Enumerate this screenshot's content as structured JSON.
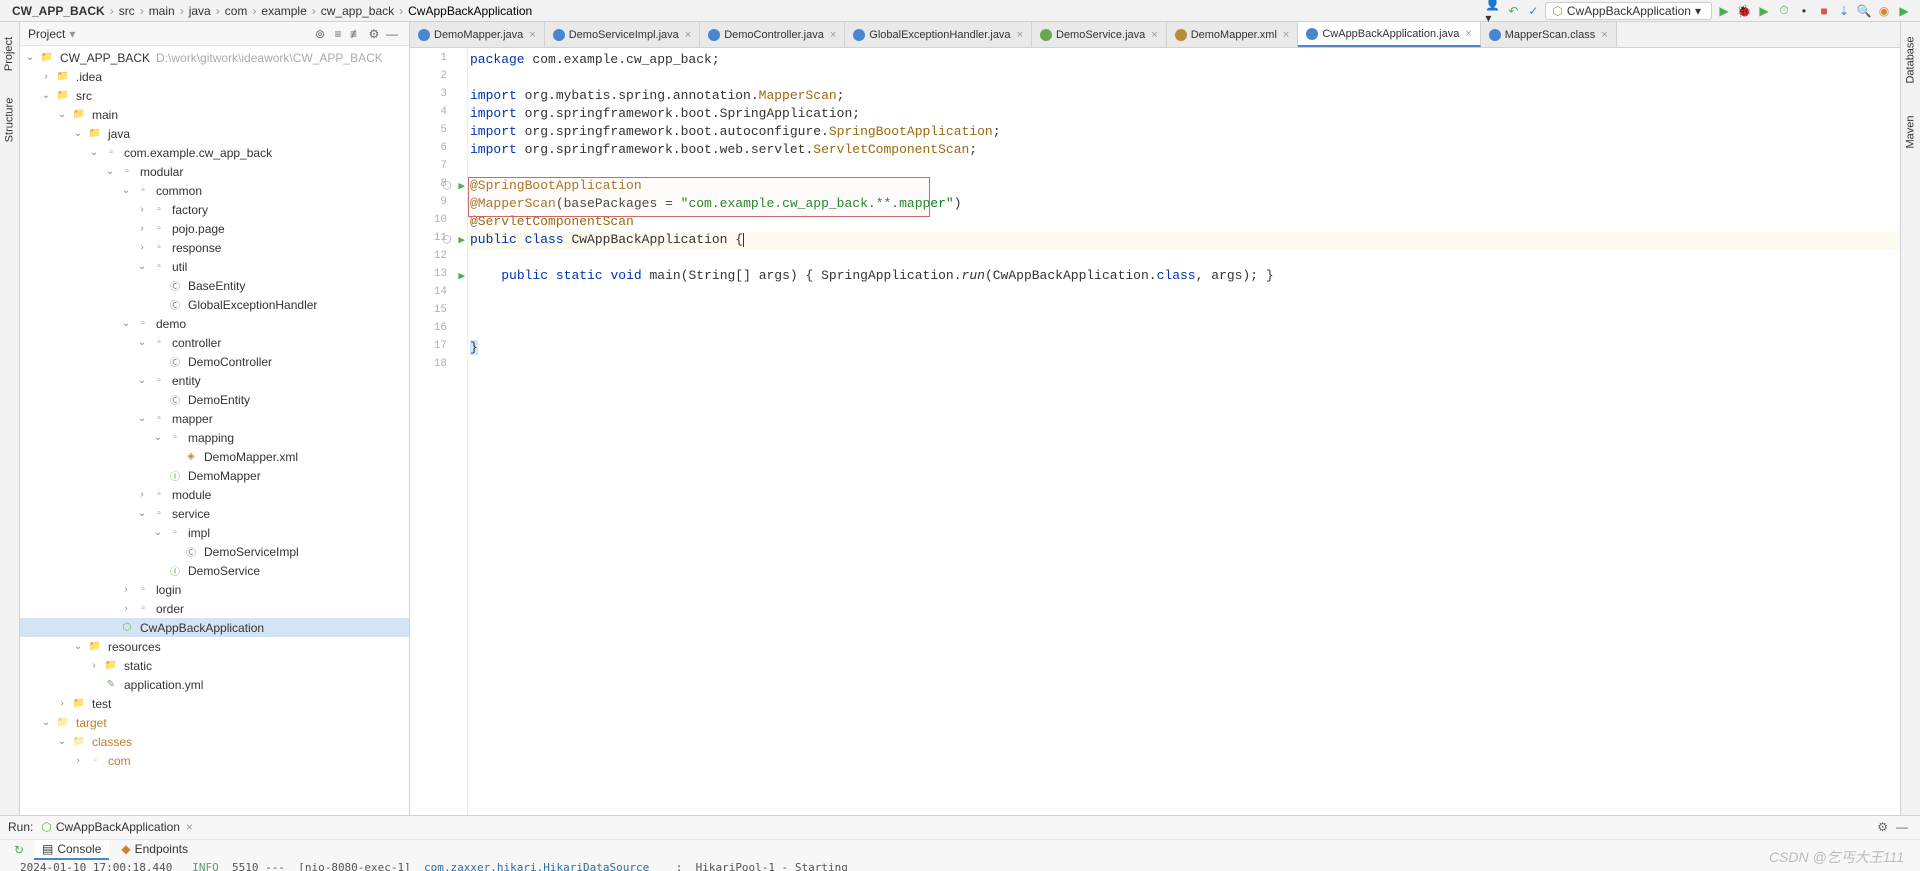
{
  "breadcrumb": {
    "items": [
      "CW_APP_BACK",
      "src",
      "main",
      "java",
      "com",
      "example",
      "cw_app_back",
      "CwAppBackApplication"
    ]
  },
  "runConfig": {
    "name": "CwAppBackApplication"
  },
  "sideLeft": [
    "Project",
    "Structure"
  ],
  "sideRight": [
    "Database",
    "Maven"
  ],
  "projectPanel": {
    "title": "Project",
    "tree": [
      {
        "d": 0,
        "a": "v",
        "i": "folder",
        "t": "CW_APP_BACK",
        "hint": "D:\\work\\gitwork\\ideawork\\CW_APP_BACK"
      },
      {
        "d": 1,
        "a": ">",
        "i": "folder",
        "t": ".idea"
      },
      {
        "d": 1,
        "a": "v",
        "i": "folder-src",
        "t": "src"
      },
      {
        "d": 2,
        "a": "v",
        "i": "folder-src",
        "t": "main"
      },
      {
        "d": 3,
        "a": "v",
        "i": "folder-src",
        "t": "java"
      },
      {
        "d": 4,
        "a": "v",
        "i": "pkg",
        "t": "com.example.cw_app_back"
      },
      {
        "d": 5,
        "a": "v",
        "i": "pkg",
        "t": "modular"
      },
      {
        "d": 6,
        "a": "v",
        "i": "pkg",
        "t": "common"
      },
      {
        "d": 7,
        "a": ">",
        "i": "pkg",
        "t": "factory"
      },
      {
        "d": 7,
        "a": ">",
        "i": "pkg",
        "t": "pojo.page"
      },
      {
        "d": 7,
        "a": ">",
        "i": "pkg",
        "t": "response"
      },
      {
        "d": 7,
        "a": "v",
        "i": "pkg",
        "t": "util"
      },
      {
        "d": 8,
        "a": "",
        "i": "jclass",
        "t": "BaseEntity"
      },
      {
        "d": 8,
        "a": "",
        "i": "jclass",
        "t": "GlobalExceptionHandler"
      },
      {
        "d": 6,
        "a": "v",
        "i": "pkg",
        "t": "demo"
      },
      {
        "d": 7,
        "a": "v",
        "i": "pkg",
        "t": "controller"
      },
      {
        "d": 8,
        "a": "",
        "i": "jclass",
        "t": "DemoController"
      },
      {
        "d": 7,
        "a": "v",
        "i": "pkg",
        "t": "entity"
      },
      {
        "d": 8,
        "a": "",
        "i": "jclass",
        "t": "DemoEntity"
      },
      {
        "d": 7,
        "a": "v",
        "i": "pkg",
        "t": "mapper"
      },
      {
        "d": 8,
        "a": "v",
        "i": "pkg",
        "t": "mapping"
      },
      {
        "d": 9,
        "a": "",
        "i": "xmlf",
        "t": "DemoMapper.xml"
      },
      {
        "d": 8,
        "a": "",
        "i": "jinterface",
        "t": "DemoMapper"
      },
      {
        "d": 7,
        "a": ">",
        "i": "pkg",
        "t": "module"
      },
      {
        "d": 7,
        "a": "v",
        "i": "pkg",
        "t": "service"
      },
      {
        "d": 8,
        "a": "v",
        "i": "pkg",
        "t": "impl"
      },
      {
        "d": 9,
        "a": "",
        "i": "jclass",
        "t": "DemoServiceImpl"
      },
      {
        "d": 8,
        "a": "",
        "i": "jinterface",
        "t": "DemoService"
      },
      {
        "d": 6,
        "a": ">",
        "i": "pkg",
        "t": "login"
      },
      {
        "d": 6,
        "a": ">",
        "i": "pkg",
        "t": "order"
      },
      {
        "d": 5,
        "a": "",
        "i": "spring",
        "t": "CwAppBackApplication",
        "sel": true
      },
      {
        "d": 3,
        "a": "v",
        "i": "folder-res",
        "t": "resources"
      },
      {
        "d": 4,
        "a": ">",
        "i": "folder",
        "t": "static"
      },
      {
        "d": 4,
        "a": "",
        "i": "yml",
        "t": "application.yml"
      },
      {
        "d": 2,
        "a": ">",
        "i": "folder-test",
        "t": "test"
      },
      {
        "d": 1,
        "a": "v",
        "i": "folder",
        "t": "target",
        "excl": true
      },
      {
        "d": 2,
        "a": "v",
        "i": "folder",
        "t": "classes",
        "excl": true
      },
      {
        "d": 3,
        "a": ">",
        "i": "pkg",
        "t": "com",
        "excl": true
      }
    ]
  },
  "tabs": [
    {
      "name": "DemoMapper.java",
      "i": "j"
    },
    {
      "name": "DemoServiceImpl.java",
      "i": "j"
    },
    {
      "name": "DemoController.java",
      "i": "j"
    },
    {
      "name": "GlobalExceptionHandler.java",
      "i": "j"
    },
    {
      "name": "DemoService.java",
      "i": "i"
    },
    {
      "name": "DemoMapper.xml",
      "i": "x"
    },
    {
      "name": "CwAppBackApplication.java",
      "i": "j",
      "active": true
    },
    {
      "name": "MapperScan.class",
      "i": "j"
    }
  ],
  "code": {
    "pkg": "com.example.cw_app_back",
    "imports": [
      {
        "p": "org.mybatis.spring.annotation.",
        "c": "MapperScan"
      },
      {
        "p": "org.springframework.boot.",
        "c": "SpringApplication"
      },
      {
        "p": "org.springframework.boot.autoconfigure.",
        "c": "SpringBootApplication"
      },
      {
        "p": "org.springframework.boot.web.servlet.",
        "c": "ServletComponentScan"
      }
    ],
    "annSpring": "@SpringBootApplication",
    "annMapper": "@MapperScan",
    "mapperArg": "(basePackages = \"com.example.cw_app_back.**.mapper\")",
    "mapperStr": "\"com.example.cw_app_back.**.mapper\"",
    "annServlet": "@ServletComponentScan",
    "className": "CwAppBackApplication",
    "mainSig": "(String[] args)",
    "mainBody": "SpringApplication.run(CwAppBackApplication.class, args);"
  },
  "runHeader": {
    "label": "Run:",
    "conf": "CwAppBackApplication"
  },
  "runTabs": [
    "Console",
    "Endpoints"
  ],
  "log": {
    "ts": "2024-01-10 17:00:18.440",
    "level": "INFO",
    "pid": "5510",
    "thread": "[nio-8080-exec-1]",
    "logger": "com.zaxxer.hikari.HikariDataSource",
    "msg": "HikariPool-1 - Starting"
  },
  "watermark": "CSDN @乞丐大王111"
}
